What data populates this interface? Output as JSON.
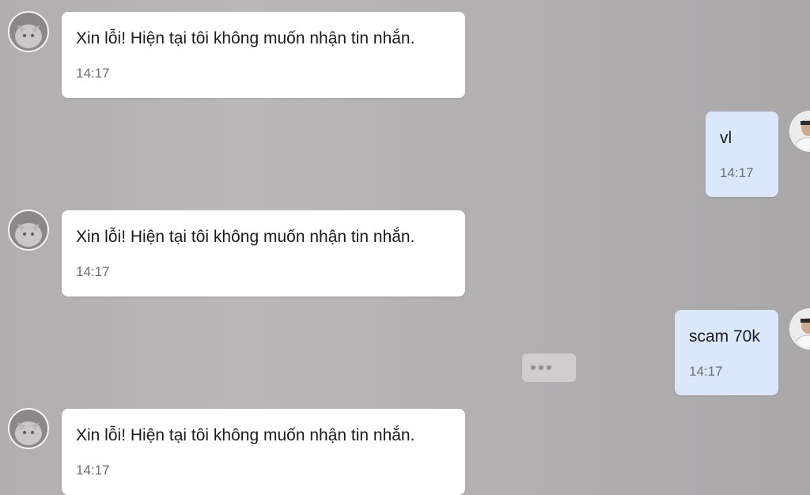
{
  "messages": [
    {
      "direction": "incoming",
      "text": "Xin lỗi! Hiện tại tôi không muốn nhận tin nhắn.",
      "time": "14:17",
      "avatar": "cat-avatar"
    },
    {
      "direction": "outgoing",
      "text": "vl",
      "time": "14:17",
      "avatar": "user-avatar"
    },
    {
      "direction": "incoming",
      "text": "Xin lỗi! Hiện tại tôi không muốn nhận tin nhắn.",
      "time": "14:17",
      "avatar": "cat-avatar"
    },
    {
      "direction": "outgoing",
      "text": "scam 70k",
      "time": "14:17",
      "avatar": "user-avatar"
    },
    {
      "direction": "incoming",
      "text": "Xin lỗi! Hiện tại tôi không muốn nhận tin nhắn.",
      "time": "14:17",
      "avatar": "cat-avatar"
    }
  ],
  "actions": {
    "more_icon": "more-horizontal-icon"
  },
  "colors": {
    "incoming_bubble": "#ffffff",
    "outgoing_bubble": "#dbe7fb",
    "timestamp": "#6e6e6e"
  }
}
